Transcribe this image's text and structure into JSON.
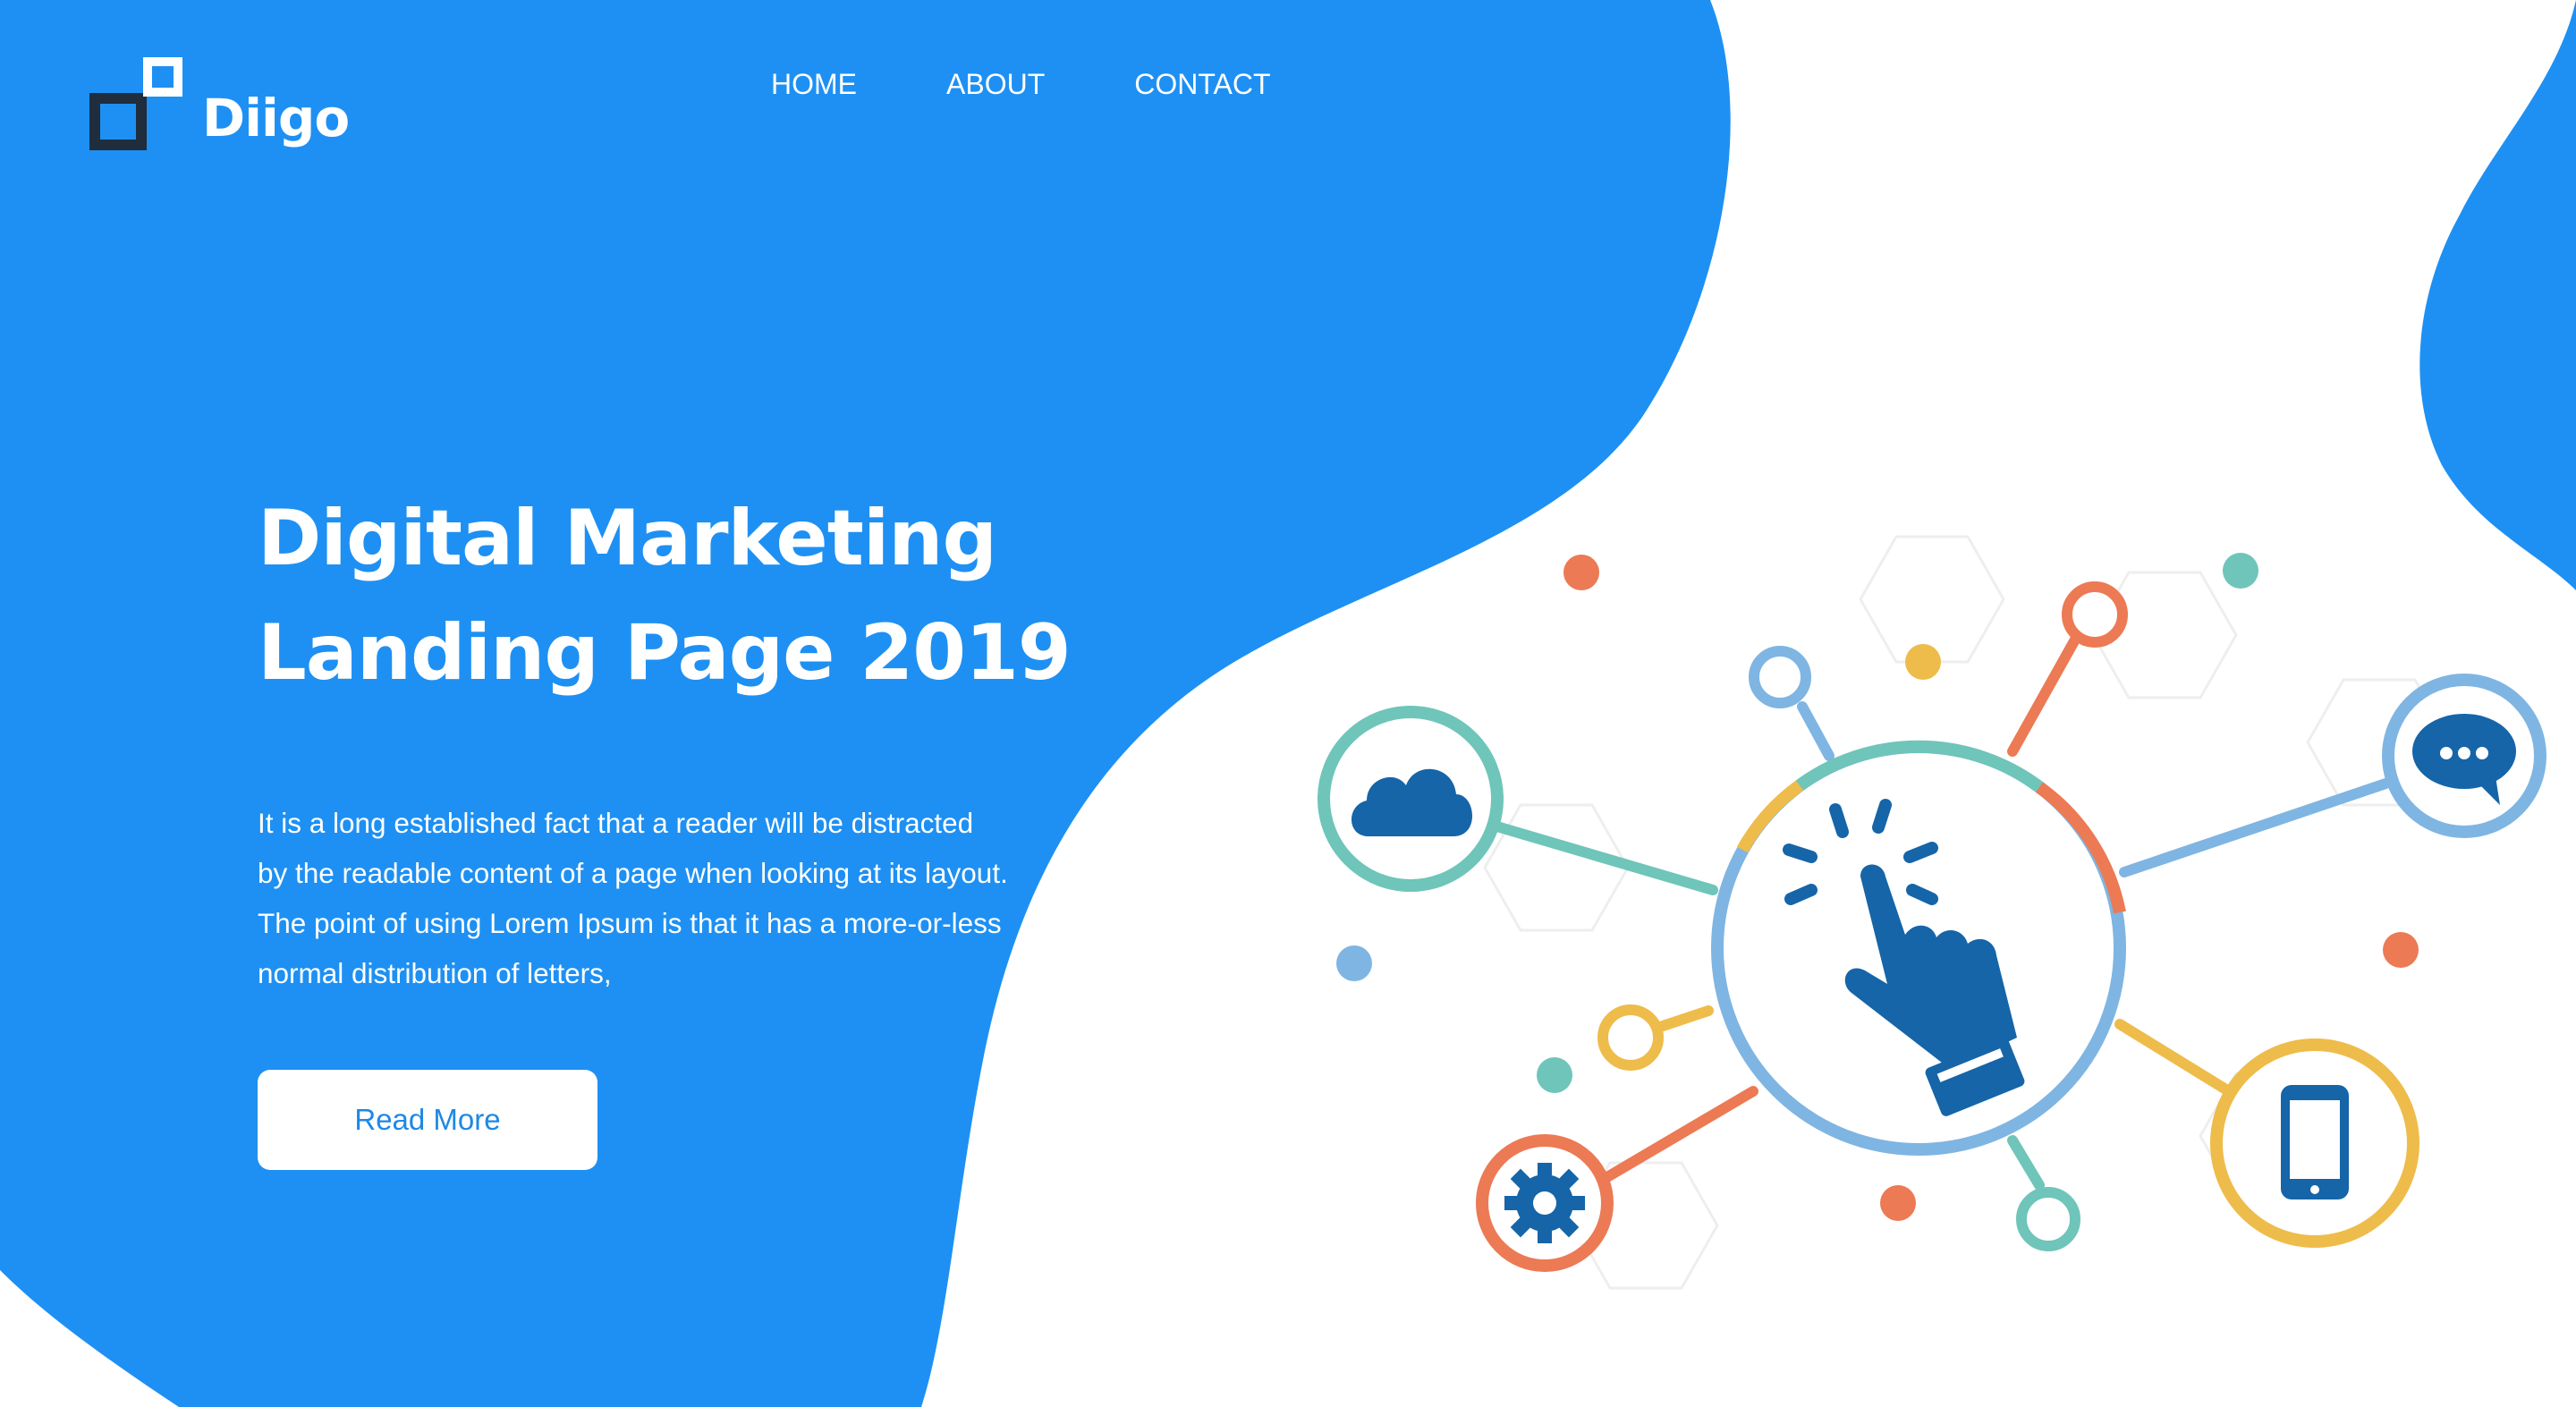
{
  "brand": {
    "name": "Diigo"
  },
  "colors": {
    "primary_blue": "#1E90F3",
    "white": "#FFFFFF",
    "dark_blue": "#1565A8",
    "teal": "#6FC5B9",
    "orange": "#EC7A54",
    "yellow": "#EEBC4A",
    "light_blue": "#7FB5E2",
    "logo_dark": "#1F2D3D"
  },
  "nav": {
    "items": [
      "HOME",
      "ABOUT",
      "CONTACT"
    ]
  },
  "hero": {
    "title_line1": "Digital Marketing",
    "title_line2": "Landing Page 2019",
    "body": "It is a long established fact that a reader will be distracted by the readable content of a page when looking at its layout. The point of using Lorem Ipsum is that it has a more-or-less normal distribution of letters,",
    "cta_label": "Read More"
  },
  "illustration": {
    "icons": [
      "cloud-icon",
      "chat-bubble-icon",
      "cursor-click-hand-icon",
      "mobile-phone-icon",
      "gear-icon"
    ]
  }
}
